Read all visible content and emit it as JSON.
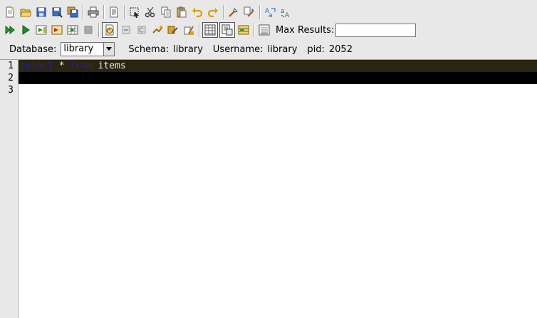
{
  "toolbar": {
    "max_results_label": "Max Results:",
    "max_results_value": ""
  },
  "infobar": {
    "database_label": "Database:",
    "database_value": "library",
    "schema_label": "Schema:",
    "schema_value": "library",
    "username_label": "Username:",
    "username_value": "library",
    "pid_label": "pid:",
    "pid_value": "2052"
  },
  "editor": {
    "line_numbers": [
      "1",
      "2",
      "3"
    ],
    "line1": {
      "kw1": "select",
      "mid": " * ",
      "kw2": "from",
      "rest": " items"
    },
    "line2": "",
    "line3": ""
  }
}
